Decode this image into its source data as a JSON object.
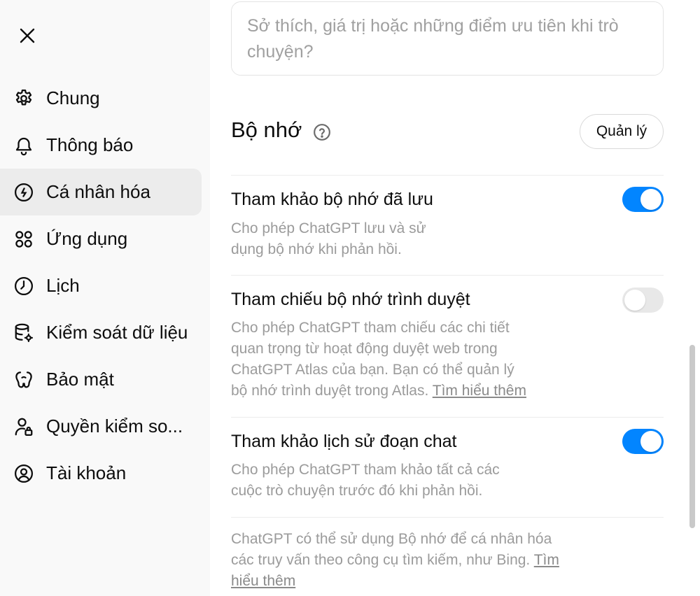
{
  "sidebar": {
    "items": [
      {
        "label": "Chung",
        "icon": "gear-icon"
      },
      {
        "label": "Thông báo",
        "icon": "bell-icon"
      },
      {
        "label": "Cá nhân hóa",
        "icon": "personalization-icon"
      },
      {
        "label": "Ứng dụng",
        "icon": "apps-grid-icon"
      },
      {
        "label": "Lịch",
        "icon": "clock-icon"
      },
      {
        "label": "Kiểm soát dữ liệu",
        "icon": "database-gear-icon"
      },
      {
        "label": "Bảo mật",
        "icon": "security-icon"
      },
      {
        "label": "Quyền kiểm so...",
        "icon": "user-lock-icon"
      },
      {
        "label": "Tài khoản",
        "icon": "account-icon"
      }
    ],
    "active_item": "Cá nhân hóa"
  },
  "main": {
    "interests_placeholder": "Sở thích, giá trị hoặc những điểm ưu tiên khi trò chuyện?",
    "memory": {
      "title": "Bộ nhớ",
      "manage_label": "Quản lý",
      "settings": [
        {
          "title": "Tham khảo bộ nhớ đã lưu",
          "desc_line1": "Cho phép ChatGPT lưu và sử",
          "desc_line2": "dụng bộ nhớ khi phản hồi.",
          "enabled": true
        },
        {
          "title": "Tham chiếu bộ nhớ trình duyệt",
          "desc_line1": "Cho phép ChatGPT tham chiếu các chi tiết",
          "desc_line2": "quan trọng từ hoạt động duyệt web trong",
          "desc_line3": "ChatGPT Atlas của bạn. Bạn có thể quản lý",
          "desc_line4": "bộ nhớ trình duyệt trong Atlas.",
          "link": "Tìm hiểu thêm",
          "enabled": false
        },
        {
          "title": "Tham khảo lịch sử đoạn chat",
          "desc_line1": "Cho phép ChatGPT tham khảo tất cả các",
          "desc_line2": "cuộc trò chuyện trước đó khi phản hồi.",
          "enabled": true
        }
      ],
      "footer_line1": "ChatGPT có thể sử dụng Bộ nhớ để cá nhân hóa",
      "footer_line2": "các truy vấn theo công cụ tìm kiếm, như Bing.",
      "footer_link_part1": "Tìm",
      "footer_link_part2": "hiểu thêm"
    }
  },
  "colors": {
    "toggle_on": "#0285ff",
    "toggle_off": "#e8e8e8",
    "sidebar_bg": "#f9f9f9",
    "active_item_bg": "#ececec"
  }
}
